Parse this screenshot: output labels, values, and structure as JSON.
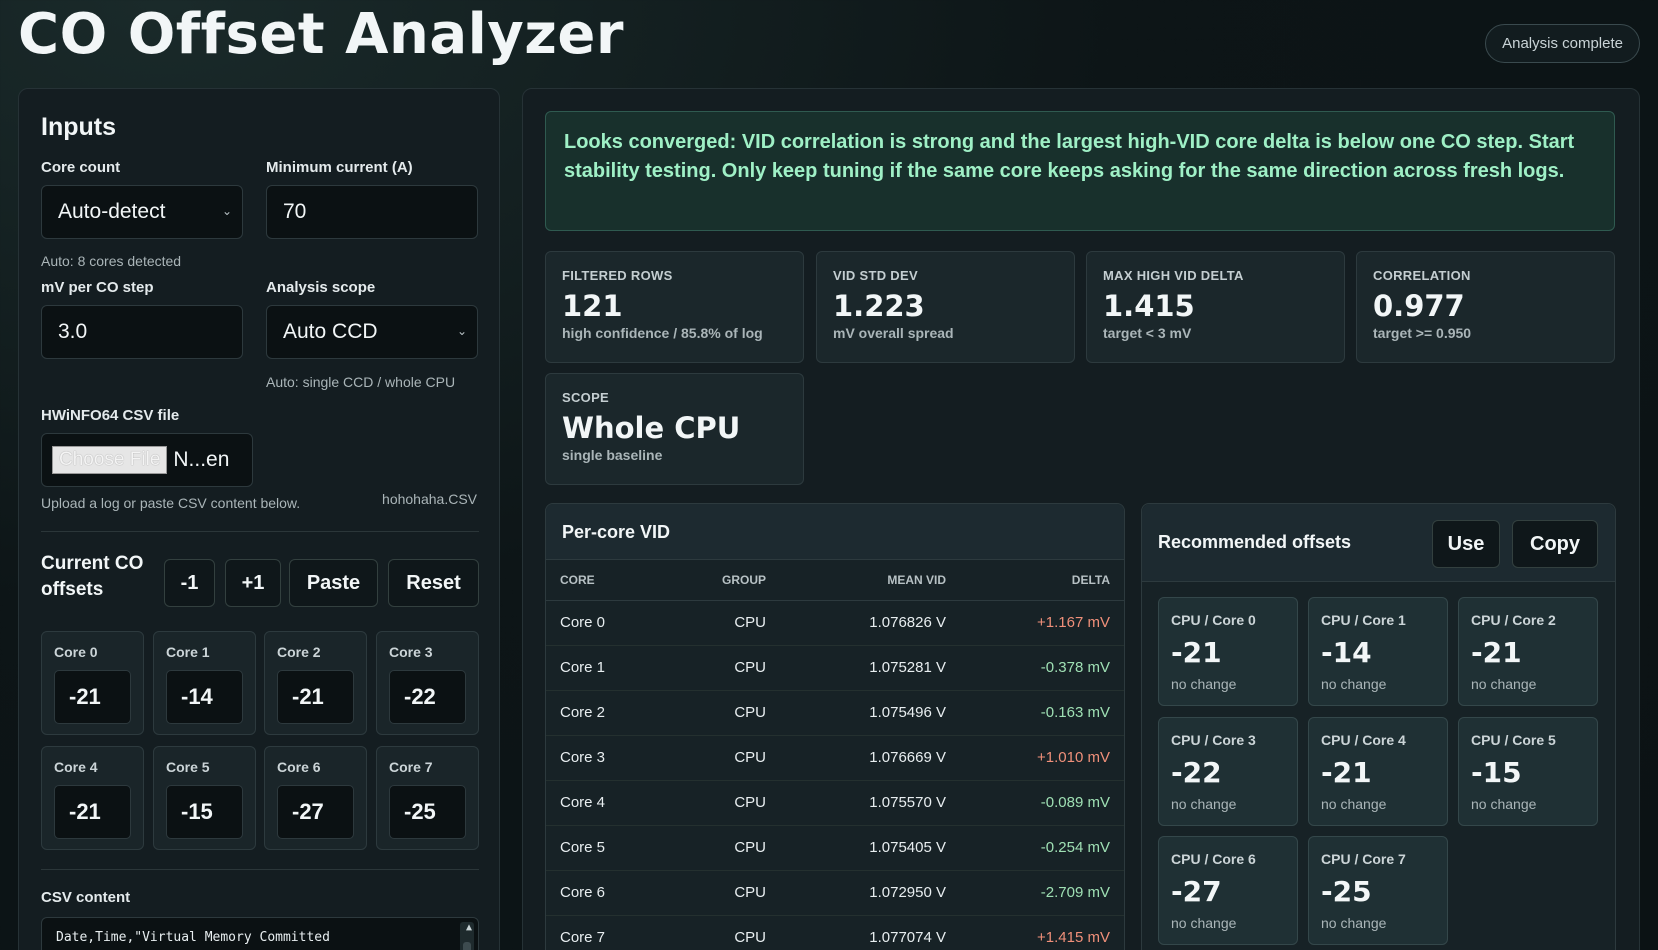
{
  "app": {
    "title": "CO Offset Analyzer",
    "status": "Analysis complete"
  },
  "inputs": {
    "heading": "Inputs",
    "core_count": {
      "label": "Core count",
      "value": "Auto-detect",
      "hint": "Auto: 8 cores detected"
    },
    "min_current": {
      "label": "Minimum current (A)",
      "value": "70"
    },
    "mv_per_step": {
      "label": "mV per CO step",
      "value": "3.0"
    },
    "scope": {
      "label": "Analysis scope",
      "value": "Auto CCD",
      "hint": "Auto: single CCD / whole CPU"
    },
    "csv_file": {
      "label": "HWiNFO64 CSV file",
      "button": "Choose File",
      "value": "N...en",
      "hint": "Upload a log or paste CSV content below.",
      "filename": "hohohaha.CSV"
    },
    "current_offsets": {
      "title": "Current CO offsets",
      "buttons": {
        "minus": "-1",
        "plus": "+1",
        "paste": "Paste",
        "reset": "Reset"
      },
      "cores": [
        {
          "label": "Core 0",
          "value": "-21"
        },
        {
          "label": "Core 1",
          "value": "-14"
        },
        {
          "label": "Core 2",
          "value": "-21"
        },
        {
          "label": "Core 3",
          "value": "-22"
        },
        {
          "label": "Core 4",
          "value": "-21"
        },
        {
          "label": "Core 5",
          "value": "-15"
        },
        {
          "label": "Core 6",
          "value": "-27"
        },
        {
          "label": "Core 7",
          "value": "-25"
        }
      ]
    },
    "csv_content": {
      "label": "CSV content",
      "value": "Date,Time,\"Virtual Memory Committed"
    }
  },
  "results": {
    "banner": "Looks converged: VID correlation is strong and the largest high-VID core delta is below one CO step. Start stability testing. Only keep tuning if the same core keeps asking for the same direction across fresh logs.",
    "stats": [
      {
        "key": "FILTERED ROWS",
        "value": "121",
        "sub": "high confidence / 85.8% of log"
      },
      {
        "key": "VID STD DEV",
        "value": "1.223",
        "sub": "mV overall spread"
      },
      {
        "key": "MAX HIGH VID DELTA",
        "value": "1.415",
        "sub": "target < 3 mV"
      },
      {
        "key": "CORRELATION",
        "value": "0.977",
        "sub": "target >= 0.950"
      },
      {
        "key": "SCOPE",
        "value": "Whole CPU",
        "sub": "single baseline"
      }
    ],
    "per_core": {
      "title": "Per-core VID",
      "columns": [
        "CORE",
        "GROUP",
        "MEAN VID",
        "DELTA"
      ],
      "rows": [
        {
          "core": "Core 0",
          "group": "CPU",
          "mean": "1.076826 V",
          "delta": "+1.167 mV"
        },
        {
          "core": "Core 1",
          "group": "CPU",
          "mean": "1.075281 V",
          "delta": "-0.378 mV"
        },
        {
          "core": "Core 2",
          "group": "CPU",
          "mean": "1.075496 V",
          "delta": "-0.163 mV"
        },
        {
          "core": "Core 3",
          "group": "CPU",
          "mean": "1.076669 V",
          "delta": "+1.010 mV"
        },
        {
          "core": "Core 4",
          "group": "CPU",
          "mean": "1.075570 V",
          "delta": "-0.089 mV"
        },
        {
          "core": "Core 5",
          "group": "CPU",
          "mean": "1.075405 V",
          "delta": "-0.254 mV"
        },
        {
          "core": "Core 6",
          "group": "CPU",
          "mean": "1.072950 V",
          "delta": "-2.709 mV"
        },
        {
          "core": "Core 7",
          "group": "CPU",
          "mean": "1.077074 V",
          "delta": "+1.415 mV"
        }
      ]
    },
    "recommended": {
      "title": "Recommended offsets",
      "use": "Use",
      "copy": "Copy",
      "cards": [
        {
          "label": "CPU / Core 0",
          "value": "-21",
          "note": "no change"
        },
        {
          "label": "CPU / Core 1",
          "value": "-14",
          "note": "no change"
        },
        {
          "label": "CPU / Core 2",
          "value": "-21",
          "note": "no change"
        },
        {
          "label": "CPU / Core 3",
          "value": "-22",
          "note": "no change"
        },
        {
          "label": "CPU / Core 4",
          "value": "-21",
          "note": "no change"
        },
        {
          "label": "CPU / Core 5",
          "value": "-15",
          "note": "no change"
        },
        {
          "label": "CPU / Core 6",
          "value": "-27",
          "note": "no change"
        },
        {
          "label": "CPU / Core 7",
          "value": "-25",
          "note": "no change"
        }
      ]
    }
  }
}
